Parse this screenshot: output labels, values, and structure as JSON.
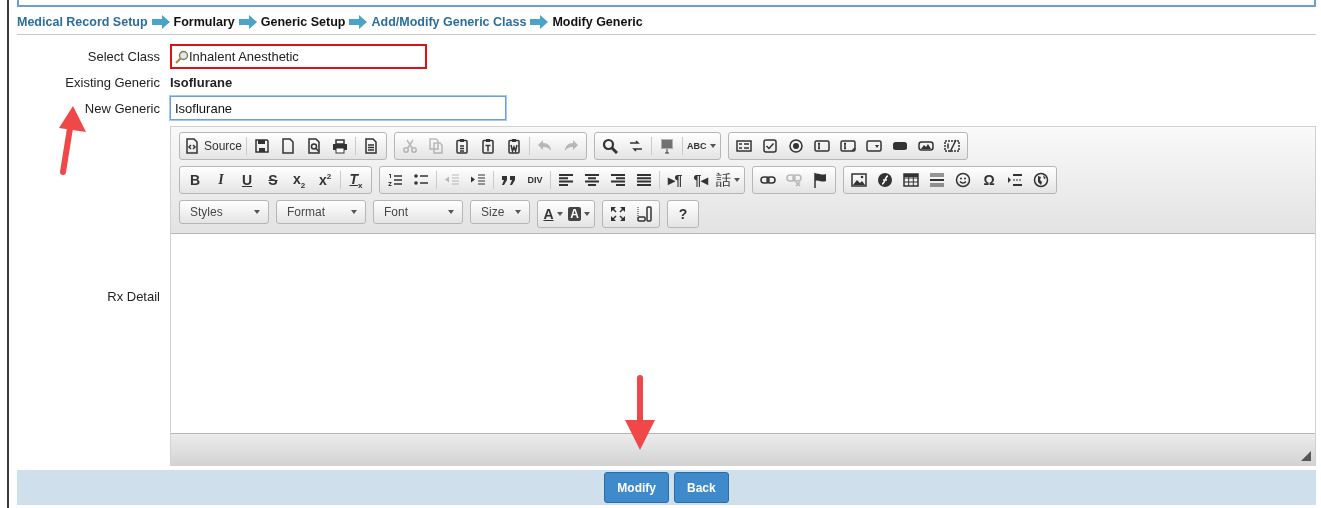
{
  "breadcrumb": [
    {
      "label": "Medical Record Setup",
      "link": true
    },
    {
      "label": "Formulary",
      "link": false
    },
    {
      "label": "Generic Setup",
      "link": false
    },
    {
      "label": "Add/Modify Generic Class",
      "link": true
    },
    {
      "label": "Modify Generic",
      "link": false
    }
  ],
  "form": {
    "select_class": {
      "label": "Select Class",
      "value": "Inhalent Anesthetic",
      "invalid": true
    },
    "existing_generic": {
      "label": "Existing Generic",
      "value": "Isoflurane"
    },
    "new_generic": {
      "label": "New Generic",
      "value": "Isoflurane",
      "focused": true
    },
    "rx_detail": {
      "label": "Rx Detail",
      "toolbar": [
        [
          [
            {
              "kind": "labeled",
              "label": "Source",
              "disabled": false
            },
            {
              "kind": "separator"
            },
            {
              "kind": "icon",
              "disabled": false
            },
            {
              "kind": "icon",
              "disabled": false
            },
            {
              "kind": "icon",
              "disabled": false
            },
            {
              "kind": "icon",
              "disabled": false
            },
            {
              "kind": "separator"
            },
            {
              "kind": "icon",
              "disabled": false
            }
          ],
          [
            {
              "kind": "icon",
              "disabled": true
            },
            {
              "kind": "icon",
              "disabled": true
            },
            {
              "kind": "icon",
              "disabled": false
            },
            {
              "kind": "icon",
              "disabled": false
            },
            {
              "kind": "icon",
              "disabled": false
            },
            {
              "kind": "separator"
            },
            {
              "kind": "icon",
              "disabled": true
            },
            {
              "kind": "icon",
              "disabled": true
            }
          ],
          [
            {
              "kind": "icon",
              "disabled": false
            },
            {
              "kind": "icon",
              "disabled": false
            },
            {
              "kind": "separator"
            },
            {
              "kind": "icon",
              "disabled": false
            },
            {
              "kind": "separator"
            },
            {
              "kind": "glyph-menu",
              "glyph": "ABC",
              "disabled": false
            }
          ],
          [
            {
              "kind": "icon",
              "disabled": false
            },
            {
              "kind": "icon",
              "disabled": false
            },
            {
              "kind": "icon",
              "disabled": false
            },
            {
              "kind": "icon",
              "disabled": false
            },
            {
              "kind": "icon",
              "disabled": false
            },
            {
              "kind": "icon",
              "disabled": false
            },
            {
              "kind": "icon",
              "disabled": false
            },
            {
              "kind": "icon",
              "disabled": false
            },
            {
              "kind": "icon",
              "disabled": false
            }
          ]
        ],
        [
          [
            {
              "kind": "glyph",
              "glyph": "B",
              "disabled": false
            },
            {
              "kind": "glyph",
              "glyph": "I",
              "disabled": false
            },
            {
              "kind": "glyph",
              "glyph": "U",
              "disabled": false
            },
            {
              "kind": "glyph",
              "glyph": "S",
              "disabled": false
            },
            {
              "kind": "glyph",
              "glyph": "x$_{2}$",
              "disabled": false
            },
            {
              "kind": "glyph",
              "glyph": "x$^{2}$",
              "disabled": false
            },
            {
              "kind": "separator"
            },
            {
              "kind": "glyph",
              "glyph": "*T*$_{x}$",
              "disabled": false
            }
          ],
          [
            {
              "kind": "icon",
              "disabled": false
            },
            {
              "kind": "icon",
              "disabled": false
            },
            {
              "kind": "separator"
            },
            {
              "kind": "icon",
              "disabled": true
            },
            {
              "kind": "icon",
              "disabled": false
            },
            {
              "kind": "separator"
            },
            {
              "kind": "icon",
              "disabled": false
            },
            {
              "kind": "glyph",
              "glyph": "DIV",
              "disabled": false
            },
            {
              "kind": "separator"
            },
            {
              "kind": "icon",
              "disabled": false
            },
            {
              "kind": "icon",
              "disabled": false
            },
            {
              "kind": "icon",
              "disabled": false
            },
            {
              "kind": "icon",
              "disabled": false
            },
            {
              "kind": "separator"
            },
            {
              "kind": "glyph",
              "glyph": "▸¶",
              "disabled": false
            },
            {
              "kind": "glyph",
              "glyph": "¶◂",
              "disabled": false
            },
            {
              "kind": "glyph-menu",
              "glyph": "話",
              "disabled": false
            }
          ],
          [
            {
              "kind": "icon",
              "disabled": false
            },
            {
              "kind": "icon",
              "disabled": true
            },
            {
              "kind": "icon",
              "disabled": false
            }
          ],
          [
            {
              "kind": "icon",
              "disabled": false
            },
            {
              "kind": "icon",
              "disabled": false
            },
            {
              "kind": "icon",
              "disabled": false
            },
            {
              "kind": "icon",
              "disabled": false
            },
            {
              "kind": "icon",
              "disabled": false
            },
            {
              "kind": "glyph",
              "glyph": "Ω",
              "disabled": false
            },
            {
              "kind": "icon",
              "disabled": false
            },
            {
              "kind": "icon",
              "disabled": false
            }
          ]
        ],
        [
          [
            {
              "kind": "combo",
              "label": "Styles"
            }
          ],
          [
            {
              "kind": "combo",
              "label": "Format"
            }
          ],
          [
            {
              "kind": "combo",
              "label": "Font"
            }
          ],
          [
            {
              "kind": "combo",
              "label": "Size"
            }
          ],
          [
            {
              "kind": "glyph-menu",
              "glyph": "A",
              "disabled": false
            },
            {
              "kind": "glyph-menu",
              "glyph": "A",
              "disabled": false
            }
          ],
          [
            {
              "kind": "icon",
              "disabled": false
            },
            {
              "kind": "icon",
              "disabled": false
            }
          ],
          [
            {
              "kind": "glyph",
              "glyph": "?",
              "disabled": false
            }
          ]
        ]
      ]
    }
  },
  "buttons": [
    {
      "label": "Modify"
    },
    {
      "label": "Back"
    }
  ]
}
